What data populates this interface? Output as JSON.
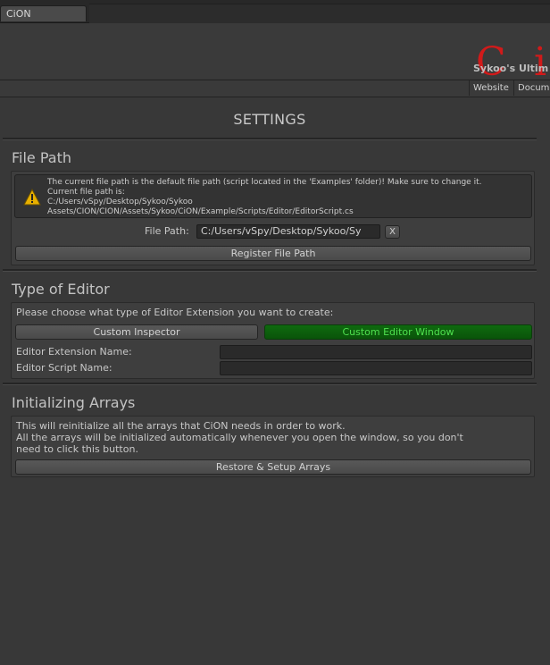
{
  "window": {
    "tab_label": "CiON"
  },
  "header": {
    "logo_c": "C",
    "logo_i": "i",
    "subtitle": "Sykoo's Ultim",
    "links": [
      "Website",
      "Docum"
    ]
  },
  "settings_title": "SETTINGS",
  "file_path_section": {
    "title": "File Path",
    "warning_icon": "warning-icon",
    "warning_lines": [
      "The current file path is the default file path (script located in the 'Examples' folder)! Make sure to change it.",
      "Current file path is:",
      "C:/Users/vSpy/Desktop/Sykoo/Sykoo",
      "Assets/CION/CION/Assets/Sykoo/CiON/Example/Scripts/Editor/EditorScript.cs"
    ],
    "field_label": "File Path:",
    "field_value": "C:/Users/vSpy/Desktop/Sykoo/Sy",
    "clear_label": "X",
    "register_label": "Register File Path"
  },
  "editor_section": {
    "title": "Type of Editor",
    "prompt": "Please choose what type of Editor Extension you want to create:",
    "option_inspector": "Custom Inspector",
    "option_window": "Custom Editor Window",
    "extension_name_label": "Editor Extension Name:",
    "extension_name_value": "",
    "script_name_label": "Editor Script Name:",
    "script_name_value": ""
  },
  "arrays_section": {
    "title": "Initializing Arrays",
    "description_lines": [
      "This will reinitialize all the arrays that CiON needs in order to work.",
      "All the arrays will be initialized automatically whenever you open the window, so you don't",
      "need to click this button."
    ],
    "button_label": "Restore & Setup Arrays"
  },
  "colors": {
    "background": "#383838",
    "logo_red": "#d11a1a",
    "active_green": "#0a540a",
    "active_text": "#4fe04f"
  }
}
